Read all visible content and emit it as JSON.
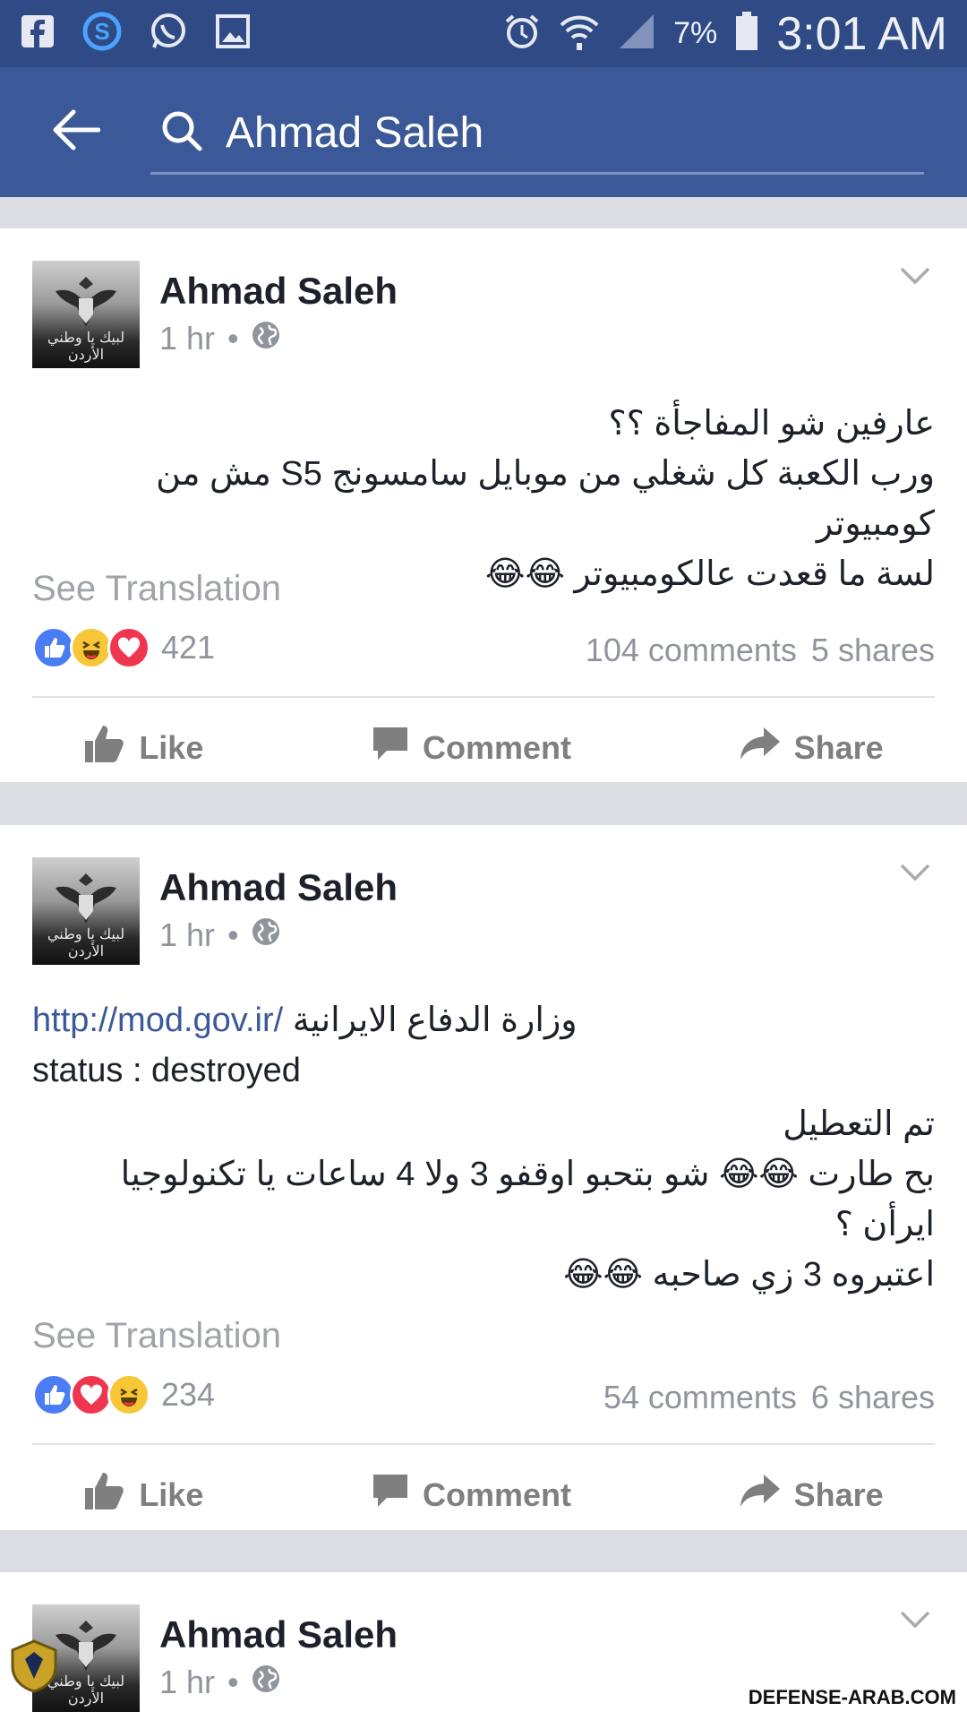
{
  "status_bar": {
    "battery": "7%",
    "time": "3:01 AM"
  },
  "app_bar": {
    "search_query": "Ahmad Saleh"
  },
  "posts": [
    {
      "author": "Ahmad Saleh",
      "time": "1 hr",
      "dot": "•",
      "avatar_caption": "لبيك يا وطني الأردن",
      "lines": [
        "عارفين شو المفاجأة ؟؟",
        "ورب الكعبة كل شغلي من موبايل سامسونج S5 مش من كومبيوتر",
        "لسة ما قعدت عالكومبيوتر 😂😂"
      ],
      "see_translation": "See Translation",
      "reaction_count": "421",
      "comments": "104 comments",
      "shares": "5 shares"
    },
    {
      "author": "Ahmad Saleh",
      "time": "1 hr",
      "dot": "•",
      "avatar_caption": "لبيك يا وطني الأردن",
      "link": "http://mod.gov.ir/",
      "link_suffix": "وزارة الدفاع الايرانية",
      "status_line": "status : destroyed",
      "lines": [
        "تم التعطيل",
        "بح طارت 😂😂 شو بتحبو  اوقفو 3 ولا 4 ساعات يا تكنولوجيا",
        "ايرأن ؟",
        "اعتبروه 3 زي صاحبه 😂😂"
      ],
      "see_translation": "See Translation",
      "reaction_count": "234",
      "comments": "54 comments",
      "shares": "6 shares"
    },
    {
      "author": "Ahmad Saleh",
      "time": "1 hr",
      "dot": "•",
      "avatar_caption": "لبيك يا وطني الأردن"
    }
  ],
  "actions": {
    "like": "Like",
    "comment": "Comment",
    "share": "Share"
  },
  "watermark": "DEFENSE-ARAB.COM",
  "colors": {
    "brand": "#3b5998",
    "status_bar": "#2f4a85",
    "like_blue": "#4a7cf4",
    "love_red": "#f0364f",
    "haha_yellow": "#f7c737"
  }
}
